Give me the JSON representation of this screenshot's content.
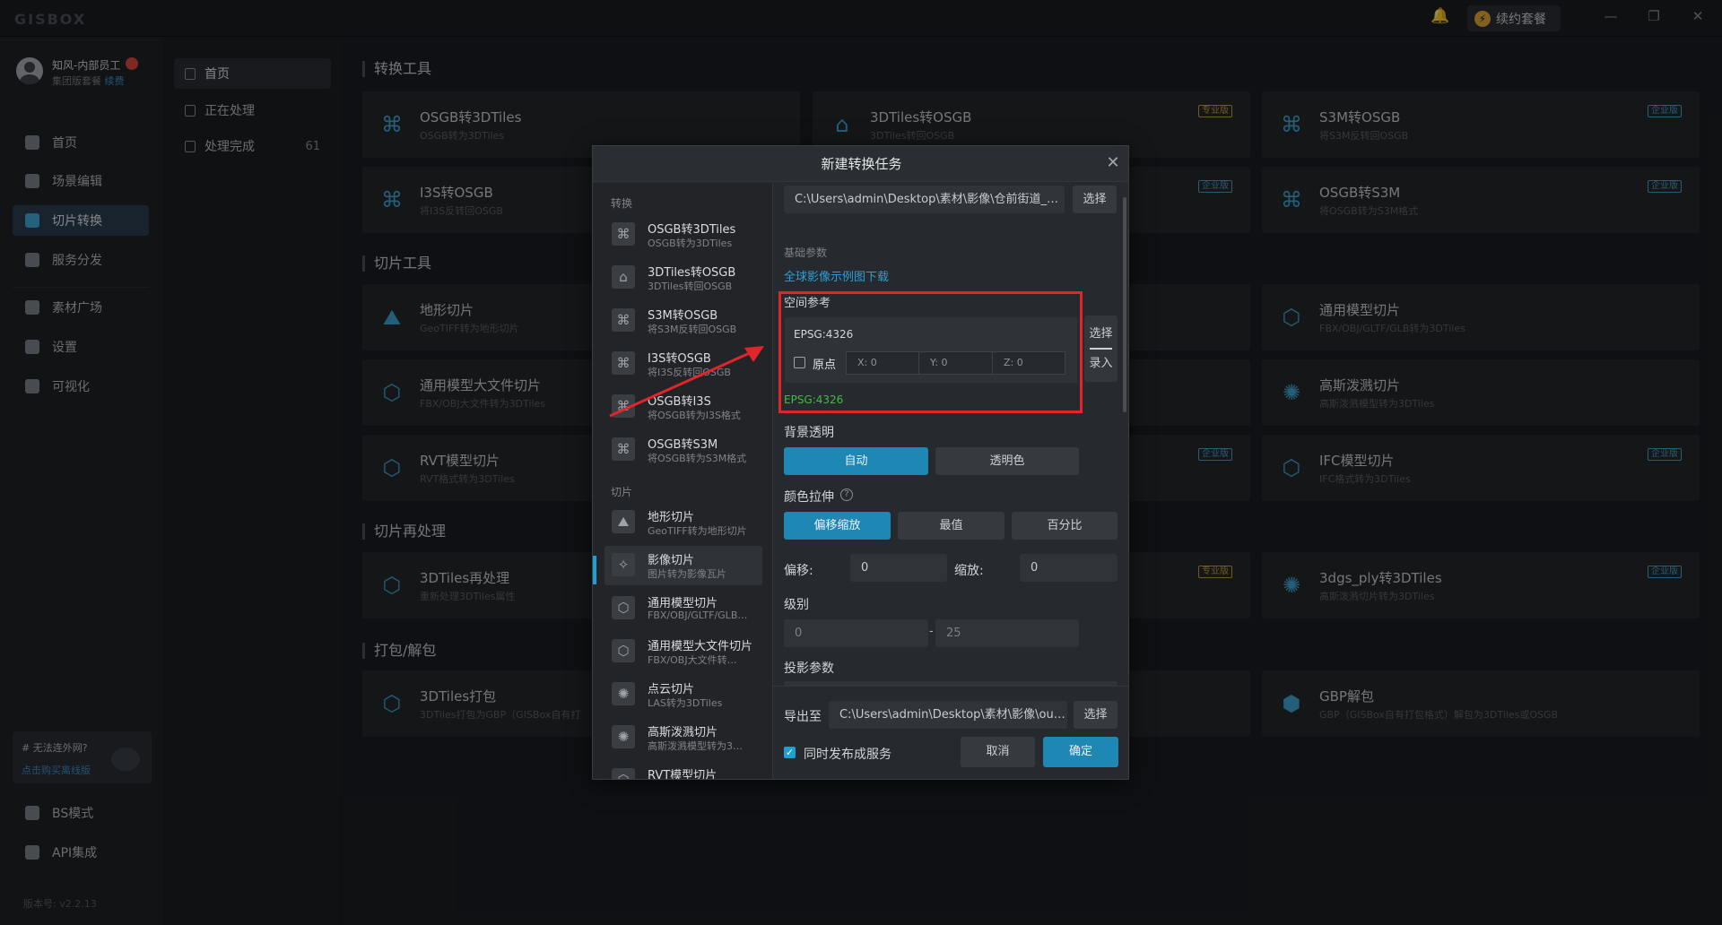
{
  "app": {
    "logo": "GISBOX",
    "renew": "续约套餐",
    "minimize": "—",
    "restore": "❐",
    "close": "✕"
  },
  "user": {
    "name": "知风-内部员工",
    "plan": "集团版套餐",
    "renew_link": "续费"
  },
  "sidebar": {
    "items": [
      {
        "label": "首页"
      },
      {
        "label": "场景编辑"
      },
      {
        "label": "切片转换"
      },
      {
        "label": "服务分发"
      },
      {
        "label": "素材广场"
      },
      {
        "label": "设置"
      },
      {
        "label": "可视化"
      }
    ],
    "offline": {
      "title": "# 无法连外网?",
      "link": "点击购买离线版"
    },
    "bottom": [
      {
        "label": "BS模式"
      },
      {
        "label": "API集成"
      }
    ],
    "version": "版本号: v2.2.13"
  },
  "subnav": {
    "items": [
      {
        "label": "首页"
      },
      {
        "label": "正在处理"
      },
      {
        "label": "处理完成",
        "count": "61"
      }
    ]
  },
  "main": {
    "sections": {
      "convert": "转换工具",
      "slice": "切片工具",
      "reprocess": "切片再处理",
      "pack": "打包/解包"
    },
    "cards": {
      "osgb3dtiles": {
        "title": "OSGB转3DTiles",
        "sub": "OSGB转为3DTiles"
      },
      "tiles2osgb": {
        "title": "3DTiles转OSGB",
        "sub": "3DTiles转回OSGB",
        "tag": "专业版"
      },
      "s3m2osgb": {
        "title": "S3M转OSGB",
        "sub": "将S3M反转回OSGB",
        "tag": "企业版"
      },
      "i3s2osgb": {
        "title": "I3S转OSGB",
        "sub": "将I3S反转回OSGB"
      },
      "mid_tag_row2": {
        "tag": "企业版"
      },
      "osgb2s3m": {
        "title": "OSGB转S3M",
        "sub": "将OSGB转为S3M格式",
        "tag": "企业版"
      },
      "terrain": {
        "title": "地形切片",
        "sub": "GeoTIFF转为地形切片"
      },
      "generic": {
        "title": "通用模型切片",
        "sub": "FBX/OBJ/GLTF/GLB转为3DTiles"
      },
      "bigfile": {
        "title": "通用模型大文件切片",
        "sub": "FBX/OBJ大文件转为3DTiles"
      },
      "gauss": {
        "title": "高斯泼溅切片",
        "sub": "高斯泼溅模型转为3DTiles"
      },
      "rvt": {
        "title": "RVT模型切片",
        "sub": "RVT格式转为3DTiles"
      },
      "mid_tag_row5": {
        "tag": "企业版"
      },
      "ifc": {
        "title": "IFC模型切片",
        "sub": "IFC格式转为3DTiles",
        "tag": "企业版"
      },
      "reproc": {
        "title": "3DTiles再处理",
        "sub": "重新处理3DTiles属性"
      },
      "mid_tag_row6": {
        "tag": "专业版"
      },
      "ply": {
        "title": "3dgs_ply转3DTiles",
        "sub": "高斯泼溅切片转为3DTiles",
        "tag": "企业版"
      },
      "pack": {
        "title": "3DTiles打包",
        "sub": "3DTiles打包为GBP（GISBox自有打"
      },
      "unpack": {
        "title": "GBP解包",
        "sub": "GBP（GISBox自有打包格式）解包为3DTiles或OSGB"
      }
    }
  },
  "modal": {
    "title": "新建转换任务",
    "categories": {
      "convert": "转换",
      "slice": "切片"
    },
    "convert_items": [
      {
        "title": "OSGB转3DTiles",
        "sub": "OSGB转为3DTiles"
      },
      {
        "title": "3DTiles转OSGB",
        "sub": "3DTiles转回OSGB"
      },
      {
        "title": "S3M转OSGB",
        "sub": "将S3M反转回OSGB"
      },
      {
        "title": "I3S转OSGB",
        "sub": "将I3S反转回OSGB"
      },
      {
        "title": "OSGB转I3S",
        "sub": "将OSGB转为I3S格式"
      },
      {
        "title": "OSGB转S3M",
        "sub": "将OSGB转为S3M格式"
      }
    ],
    "slice_items": [
      {
        "title": "地形切片",
        "sub": "GeoTIFF转为地形切片"
      },
      {
        "title": "影像切片",
        "sub": "图片转为影像瓦片"
      },
      {
        "title": "通用模型切片",
        "sub": "FBX/OBJ/GLTF/GLB…"
      },
      {
        "title": "通用模型大文件切片",
        "sub": "FBX/OBJ大文件转…"
      },
      {
        "title": "点云切片",
        "sub": "LAS转为3DTiles"
      },
      {
        "title": "高斯泼溅切片",
        "sub": "高斯泼溅模型转为3…"
      },
      {
        "title": "RVT模型切片",
        "sub": ""
      }
    ],
    "input_path": "C:\\Users\\admin\\Desktop\\素材\\影像\\仓前街道_…",
    "select": "选择",
    "basic_params": "基础参数",
    "global_link": "全球影像示例图下载",
    "spatial_ref": "空间参考",
    "epsg_value": "EPSG:4326",
    "origin": "原点",
    "x": "X: 0",
    "y": "Y: 0",
    "z": "Z: 0",
    "select2": "选择",
    "enter": "录入",
    "epsg_green": "EPSG:4326",
    "bg_transparent": "背景透明",
    "auto": "自动",
    "transparent_color": "透明色",
    "color_stretch": "颜色拉伸",
    "help": "?",
    "offset_scale": "偏移缩放",
    "extreme": "最值",
    "percent": "百分比",
    "offset_label": "偏移:",
    "offset_value": "0",
    "scale_label": "缩放:",
    "scale_value": "0",
    "level": "级别",
    "level_min": "0",
    "level_dash": "-",
    "level_max": "25",
    "projection": "投影参数",
    "export_to": "导出至",
    "output_path": "C:\\Users\\admin\\Desktop\\素材\\影像\\out…",
    "select3": "选择",
    "publish": "同时发布成服务",
    "cancel": "取消",
    "confirm": "确定"
  },
  "colors": {
    "accent": "#1f87b4",
    "highlight_box": "#e0262a",
    "epsg_green": "#3fbf3f",
    "link": "#3d8ec9"
  }
}
